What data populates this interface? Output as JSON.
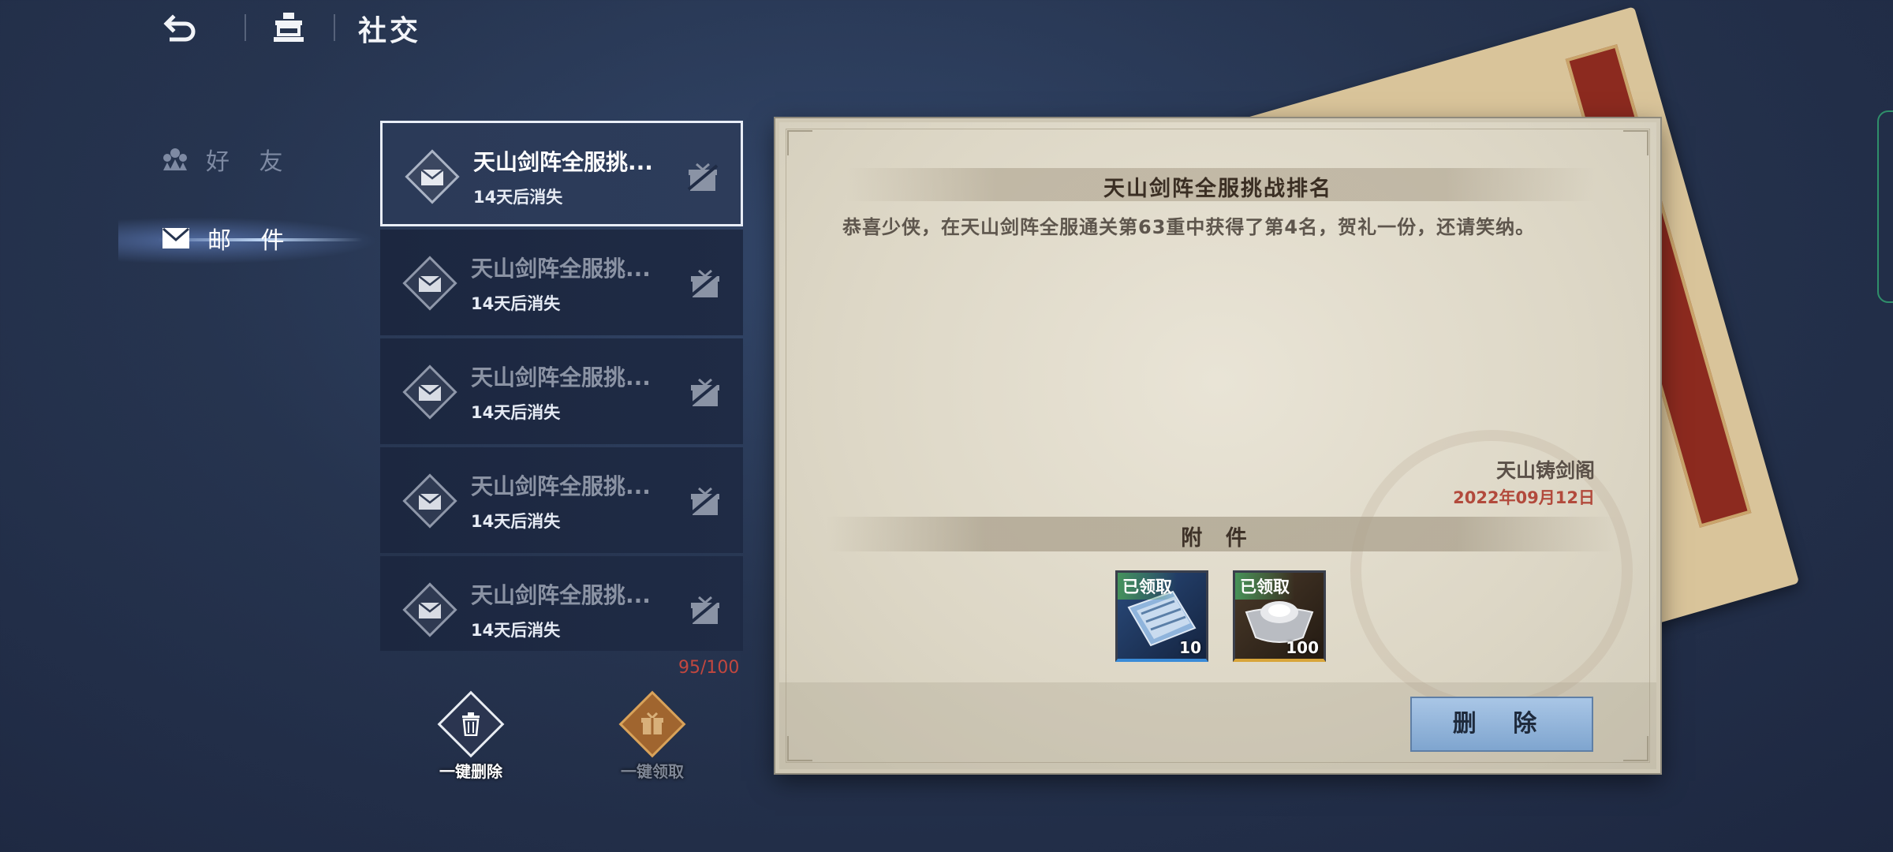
{
  "topbar": {
    "back_icon": "back-arrow-icon",
    "home_icon": "pavilion-icon",
    "title": "社交"
  },
  "nav": {
    "items": [
      {
        "label": "好 友",
        "icon": "friends-icon",
        "active": false
      },
      {
        "label": "邮 件",
        "icon": "mail-icon",
        "active": true
      }
    ]
  },
  "mail_list": {
    "items": [
      {
        "title": "天山剑阵全服挑...",
        "expire": "14天后消失",
        "selected": true
      },
      {
        "title": "天山剑阵全服挑...",
        "expire": "14天后消失",
        "selected": false
      },
      {
        "title": "天山剑阵全服挑...",
        "expire": "14天后消失",
        "selected": false
      },
      {
        "title": "天山剑阵全服挑...",
        "expire": "14天后消失",
        "selected": false
      },
      {
        "title": "天山剑阵全服挑...",
        "expire": "14天后消失",
        "selected": false
      }
    ],
    "count": "95/100",
    "delete_all_label": "一键删除",
    "claim_all_label": "一键领取"
  },
  "letter": {
    "title": "天山剑阵全服挑战排名",
    "body": "恭喜少侠，在天山剑阵全服通关第63重中获得了第4名，贺礼一份，还请笑纳。",
    "sender": "天山铸剑阁",
    "date": "2022年09月12日",
    "attachments_title": "附 件",
    "attachments": [
      {
        "tag": "已领取",
        "quantity": "10",
        "icon": "ticket-icon"
      },
      {
        "tag": "已领取",
        "quantity": "100",
        "icon": "silver-ingot-icon"
      }
    ],
    "delete_label": "删 除"
  },
  "colors": {
    "background": "#26344f",
    "paper": "#e4dfd0",
    "date_red": "#b24a3c",
    "count_red": "#c2473f",
    "delete_button": "#93b5dc"
  }
}
